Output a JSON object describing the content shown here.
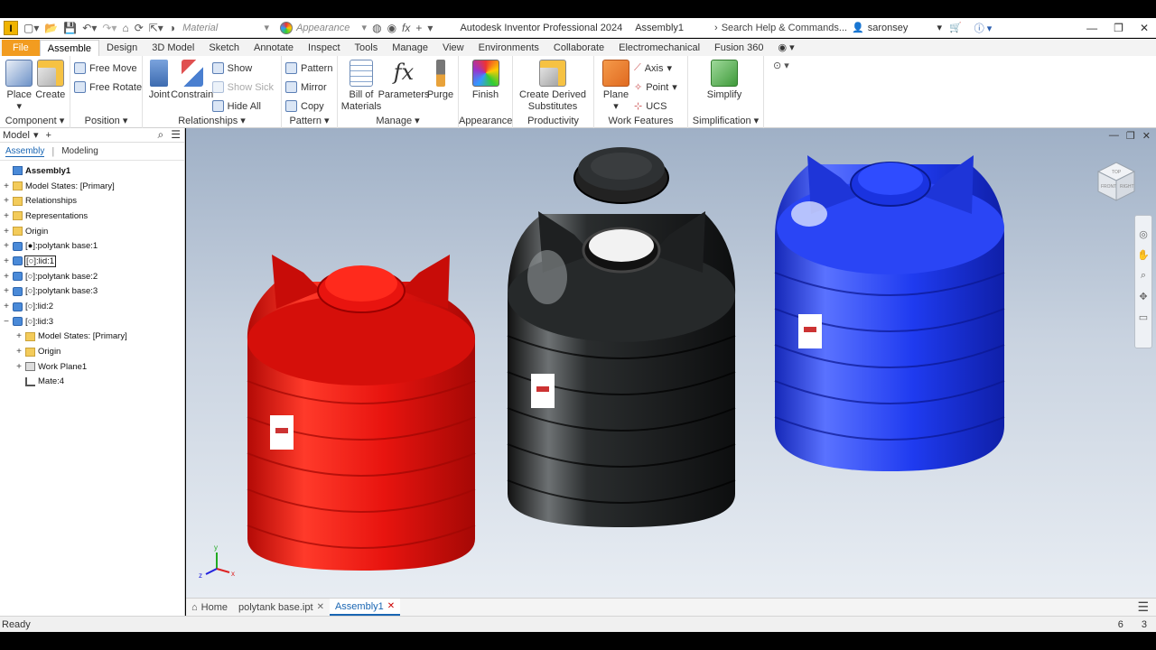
{
  "app": {
    "title": "Autodesk Inventor Professional 2024",
    "document": "Assembly1",
    "logo_letter": "I"
  },
  "quick_access": {
    "material_placeholder": "Material",
    "appearance_placeholder": "Appearance",
    "search_label": "Search Help & Commands...",
    "user": "saronsey"
  },
  "tabs": [
    "File",
    "Assemble",
    "Design",
    "3D Model",
    "Sketch",
    "Annotate",
    "Inspect",
    "Tools",
    "Manage",
    "View",
    "Environments",
    "Collaborate",
    "Electromechanical",
    "Fusion 360"
  ],
  "ribbon": {
    "component": {
      "title": "Component",
      "place": "Place",
      "create": "Create"
    },
    "position": {
      "title": "Position",
      "free_move": "Free Move",
      "free_rotate": "Free Rotate"
    },
    "relationships": {
      "title": "Relationships",
      "joint": "Joint",
      "constrain": "Constrain",
      "show": "Show",
      "show_sick": "Show Sick",
      "hide_all": "Hide All"
    },
    "pattern": {
      "title": "Pattern",
      "pattern": "Pattern",
      "mirror": "Mirror",
      "copy": "Copy"
    },
    "manage": {
      "title": "Manage",
      "bom": "Bill of\nMaterials",
      "bom_line1": "Bill of",
      "bom_line2": "Materials",
      "parameters": "Parameters",
      "purge": "Purge"
    },
    "appearance": {
      "title": "Appearance",
      "finish": "Finish"
    },
    "productivity": {
      "title": "Productivity",
      "create_derived_line1": "Create Derived",
      "create_derived_line2": "Substitutes"
    },
    "work_features": {
      "title": "Work Features",
      "plane": "Plane",
      "axis": "Axis",
      "point": "Point",
      "ucs": "UCS"
    },
    "simplification": {
      "title": "Simplification",
      "simplify": "Simplify"
    }
  },
  "browser": {
    "title": "Model",
    "tabs": [
      "Assembly",
      "Modeling"
    ],
    "tree": [
      {
        "label": "Assembly1",
        "indent": 0,
        "icon": "asm",
        "expander": "",
        "bold": true
      },
      {
        "label": "Model States: [Primary]",
        "indent": 0,
        "icon": "folder",
        "expander": "+"
      },
      {
        "label": "Relationships",
        "indent": 0,
        "icon": "folder",
        "expander": "+"
      },
      {
        "label": "Representations",
        "indent": 0,
        "icon": "folder",
        "expander": "+"
      },
      {
        "label": "Origin",
        "indent": 0,
        "icon": "folder",
        "expander": "+"
      },
      {
        "label": "[●]:polytank base:1",
        "indent": 0,
        "icon": "part",
        "expander": "+"
      },
      {
        "label": "[○]:lid:1",
        "indent": 0,
        "icon": "part",
        "expander": "+",
        "selected": true
      },
      {
        "label": "[○]:polytank base:2",
        "indent": 0,
        "icon": "part",
        "expander": "+"
      },
      {
        "label": "[○]:polytank base:3",
        "indent": 0,
        "icon": "part",
        "expander": "+"
      },
      {
        "label": "[○]:lid:2",
        "indent": 0,
        "icon": "part",
        "expander": "+"
      },
      {
        "label": "[○]:lid:3",
        "indent": 0,
        "icon": "part",
        "expander": "−"
      },
      {
        "label": "Model States: [Primary]",
        "indent": 1,
        "icon": "folder",
        "expander": "+"
      },
      {
        "label": "Origin",
        "indent": 1,
        "icon": "folder",
        "expander": "+"
      },
      {
        "label": "Work Plane1",
        "indent": 1,
        "icon": "plane",
        "expander": "+"
      },
      {
        "label": "Mate:4",
        "indent": 1,
        "icon": "mate",
        "expander": ""
      }
    ]
  },
  "viewport": {
    "tanks": [
      {
        "name": "red-tank",
        "color": "#e8140f",
        "dark": "#a50805",
        "light": "#ff4a3a"
      },
      {
        "name": "black-tank",
        "color": "#2a2d2e",
        "dark": "#0d0e0f",
        "light": "#6a6e70"
      },
      {
        "name": "blue-tank",
        "color": "#1f3bf0",
        "dark": "#0f1fa8",
        "light": "#5a72ff"
      }
    ],
    "viewcube_faces": [
      "TOP",
      "FRONT",
      "RIGHT"
    ],
    "triad_axes": [
      "x",
      "y",
      "z"
    ]
  },
  "doc_tabs": [
    {
      "label": "Home",
      "closable": false,
      "active": false
    },
    {
      "label": "polytank base.ipt",
      "closable": true,
      "active": false
    },
    {
      "label": "Assembly1",
      "closable": true,
      "active": true
    }
  ],
  "status": {
    "text": "Ready",
    "count1": "6",
    "count2": "3"
  }
}
